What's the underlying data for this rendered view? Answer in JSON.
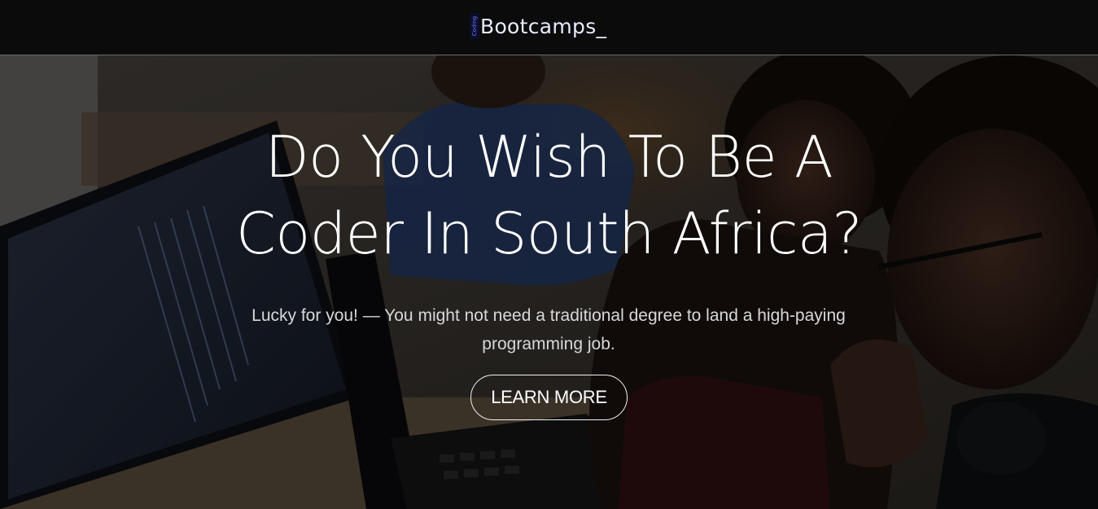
{
  "header": {
    "logo_small": "Coding",
    "logo_text": "Bootcamps_"
  },
  "hero": {
    "headline_line1": "Do You Wish To Be A",
    "headline_line2": "Coder In South Africa?",
    "subheading_line1": "Lucky for you! — You might not need a traditional degree to land a high-paying",
    "subheading_line2": "programming job.",
    "cta_label": "LEARN MORE",
    "background_image": "photo-of-coders-at-laptop"
  },
  "colors": {
    "header_bg": "#0b0b0b",
    "text_white": "#ffffff",
    "subtext": "#d8d8d8",
    "logo_accent": "#6a7bff"
  }
}
